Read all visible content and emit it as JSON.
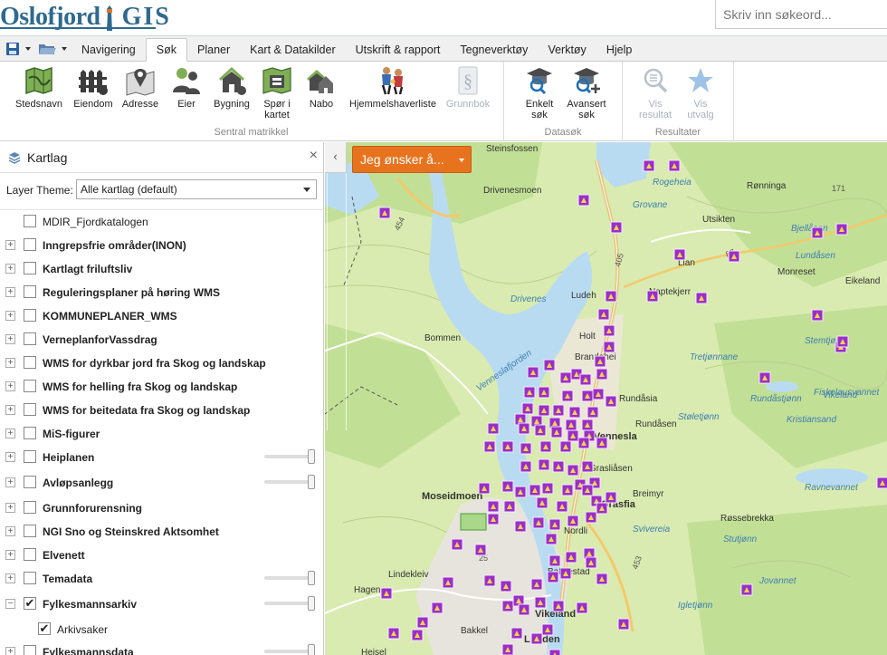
{
  "header": {
    "logo_text": "Oslofjord",
    "logo_gis": "GIS",
    "search_placeholder": "Skriv inn søkeord..."
  },
  "tabs": [
    "Navigering",
    "Søk",
    "Planer",
    "Kart & Datakilder",
    "Utskrift & rapport",
    "Tegneverktøy",
    "Verktøy",
    "Hjelp"
  ],
  "active_tab": "Søk",
  "ribbon": {
    "buttons": [
      {
        "id": "stedsnavn",
        "label": "Stedsnavn",
        "icon": "map-icon"
      },
      {
        "id": "eiendom",
        "label": "Eiendom",
        "icon": "fence-icon"
      },
      {
        "id": "adresse",
        "label": "Adresse",
        "icon": "location-pin-icon"
      },
      {
        "id": "eier",
        "label": "Eier",
        "icon": "people-icon"
      },
      {
        "id": "bygning",
        "label": "Bygning",
        "icon": "house-icon"
      },
      {
        "id": "spor",
        "label": "Spør i kartet",
        "line1": "Spør i",
        "line2": "kartet",
        "icon": "map-query-icon"
      },
      {
        "id": "nabo",
        "label": "Nabo",
        "icon": "neighbor-houses-icon"
      },
      {
        "id": "hjemmel",
        "label": "Hjemmelshaverliste",
        "icon": "family-icon"
      },
      {
        "id": "grunnbok",
        "label": "Grunnbok",
        "icon": "paragraph-icon",
        "disabled": true
      },
      {
        "id": "enkelt",
        "label": "Enkelt søk",
        "line1": "Enkelt",
        "line2": "søk",
        "icon": "graduate-search-icon"
      },
      {
        "id": "avansert",
        "label": "Avansert søk",
        "line1": "Avansert",
        "line2": "søk",
        "icon": "graduate-add-icon"
      },
      {
        "id": "vis-resultat",
        "label": "Vis resultat",
        "line1": "Vis",
        "line2": "resultat",
        "icon": "list-magnifier-icon",
        "disabled": true
      },
      {
        "id": "vis-utvalg",
        "label": "Vis utvalg",
        "line1": "Vis",
        "line2": "utvalg",
        "icon": "star-icon",
        "disabled": true
      }
    ],
    "groups": [
      "Sentral matrikkel",
      "Datasøk",
      "Resultater"
    ]
  },
  "panel": {
    "title": "Kartlag",
    "theme_label": "Layer Theme:",
    "theme_value": "Alle kartlag (default)",
    "layers": [
      {
        "label": "MDIR_Fjordkatalogen",
        "bold": false,
        "expander": "",
        "checked": false,
        "slider": false
      },
      {
        "label": "Inngrepsfrie områder(INON)",
        "bold": true,
        "expander": "+",
        "checked": false,
        "slider": false
      },
      {
        "label": "Kartlagt friluftsliv",
        "bold": true,
        "expander": "+",
        "checked": false,
        "slider": false
      },
      {
        "label": "Reguleringsplaner på høring WMS",
        "bold": true,
        "expander": "+",
        "checked": false,
        "slider": false
      },
      {
        "label": "KOMMUNEPLANER_WMS",
        "bold": true,
        "expander": "+",
        "checked": false,
        "slider": false
      },
      {
        "label": "VerneplanforVassdrag",
        "bold": true,
        "expander": "+",
        "checked": false,
        "slider": false
      },
      {
        "label": "WMS for dyrkbar jord fra Skog og landskap",
        "bold": true,
        "expander": "+",
        "checked": false,
        "slider": false
      },
      {
        "label": "WMS for helling fra Skog og landskap",
        "bold": true,
        "expander": "+",
        "checked": false,
        "slider": false
      },
      {
        "label": "WMS for beitedata fra Skog og landskap",
        "bold": true,
        "expander": "+",
        "checked": false,
        "slider": false
      },
      {
        "label": "MiS-figurer",
        "bold": true,
        "expander": "+",
        "checked": false,
        "slider": false
      },
      {
        "label": "Heiplanen",
        "bold": true,
        "expander": "+",
        "checked": false,
        "slider": true
      },
      {
        "label": "Avløpsanlegg",
        "bold": true,
        "expander": "+",
        "checked": false,
        "slider": true
      },
      {
        "label": "Grunnforurensning",
        "bold": true,
        "expander": "+",
        "checked": false,
        "slider": false
      },
      {
        "label": "NGI Sno og Steinskred Aktsomhet",
        "bold": true,
        "expander": "+",
        "checked": false,
        "slider": false
      },
      {
        "label": "Elvenett",
        "bold": true,
        "expander": "+",
        "checked": false,
        "slider": false
      },
      {
        "label": "Temadata",
        "bold": true,
        "expander": "+",
        "checked": false,
        "slider": true
      },
      {
        "label": "Fylkesmannsarkiv",
        "bold": true,
        "expander": "−",
        "checked": true,
        "slider": true
      },
      {
        "label": "Arkivsaker",
        "bold": false,
        "expander": "",
        "checked": true,
        "slider": false,
        "indent": true
      },
      {
        "label": "Fylkesmannsdata",
        "bold": true,
        "expander": "+",
        "checked": false,
        "slider": true
      }
    ]
  },
  "map": {
    "wish_button": "Jeg ønsker å...",
    "collapse_glyph": "‹",
    "place_names": [
      {
        "name": "Steinsfossen",
        "bold": false,
        "italic": false
      },
      {
        "name": "Drivenesmoen",
        "bold": false,
        "italic": false
      },
      {
        "name": "Grovane",
        "bold": false,
        "italic": true
      },
      {
        "name": "Rogeheia",
        "bold": false,
        "italic": true
      },
      {
        "name": "Rønninga",
        "bold": false,
        "italic": false
      },
      {
        "name": "Utsikten",
        "bold": false,
        "italic": false
      },
      {
        "name": "Bjellåsen",
        "bold": false,
        "italic": true
      },
      {
        "name": "Lundåsen",
        "bold": false,
        "italic": true
      },
      {
        "name": "Monreset",
        "bold": false,
        "italic": false
      },
      {
        "name": "Eikeland",
        "bold": false,
        "italic": false
      },
      {
        "name": "Lian",
        "bold": false,
        "italic": false
      },
      {
        "name": "Ludeh",
        "bold": false,
        "italic": false
      },
      {
        "name": "Naptekjerr",
        "bold": false,
        "italic": false
      },
      {
        "name": "Drivenes",
        "bold": false,
        "italic": true
      },
      {
        "name": "Bommen",
        "bold": false,
        "italic": false
      },
      {
        "name": "Vennesla­fjorden",
        "bold": false,
        "italic": true
      },
      {
        "name": "Holt",
        "bold": false,
        "italic": false
      },
      {
        "name": "Stemtjønn",
        "bold": false,
        "italic": true
      },
      {
        "name": "Tretjønnane",
        "bold": false,
        "italic": true
      },
      {
        "name": "Brandehei",
        "bold": false,
        "italic": false
      },
      {
        "name": "Rundåsia",
        "bold": false,
        "italic": false
      },
      {
        "name": "Rundåstjønn",
        "bold": false,
        "italic": true
      },
      {
        "name": "Fiskelausvannet",
        "bold": false,
        "italic": true
      },
      {
        "name": "Vennesla",
        "bold": true,
        "italic": false
      },
      {
        "name": "Rundåsen",
        "bold": false,
        "italic": false
      },
      {
        "name": "Vikeland",
        "bold": false,
        "italic": true
      },
      {
        "name": "Kristiansand",
        "bold": false,
        "italic": true
      },
      {
        "name": "Støletjønn",
        "bold": false,
        "italic": true
      },
      {
        "name": "Grasliåsen",
        "bold": false,
        "italic": false
      },
      {
        "name": "Moseidmoen",
        "bold": true,
        "italic": false
      },
      {
        "name": "Breimyr",
        "bold": false,
        "italic": false
      },
      {
        "name": "Grasfia",
        "bold": true,
        "italic": false
      },
      {
        "name": "Ravnevannet",
        "bold": false,
        "italic": true
      },
      {
        "name": "Røssebrekka",
        "bold": false,
        "italic": false
      },
      {
        "name": "Svivereia",
        "bold": false,
        "italic": true
      },
      {
        "name": "Stutjønn",
        "bold": false,
        "italic": true
      },
      {
        "name": "Nordli",
        "bold": false,
        "italic": false
      },
      {
        "name": "Jovannet",
        "bold": false,
        "italic": true
      },
      {
        "name": "Lindekleiv",
        "bold": false,
        "italic": false
      },
      {
        "name": "Hagen",
        "bold": false,
        "italic": false
      },
      {
        "name": "Bakkestad",
        "bold": false,
        "italic": false
      },
      {
        "name": "Igletjønn",
        "bold": false,
        "italic": true
      },
      {
        "name": "Vikeland",
        "bold": true,
        "italic": false
      },
      {
        "name": "Bakkel",
        "bold": false,
        "italic": false
      },
      {
        "name": "Lunden",
        "bold": true,
        "italic": false
      },
      {
        "name": "Heisel",
        "bold": false,
        "italic": false
      }
    ],
    "road_labels": [
      "454",
      "405",
      "87",
      "453",
      "171",
      "25"
    ],
    "marker_icon": "archive-case-marker-icon",
    "colors": {
      "land": "#d9ebb0",
      "forest": "#c4e09a",
      "water": "#b9dbf2",
      "urban": "#e8e6e0",
      "marker": "#9b2ec8",
      "button": "#e8731e"
    }
  }
}
